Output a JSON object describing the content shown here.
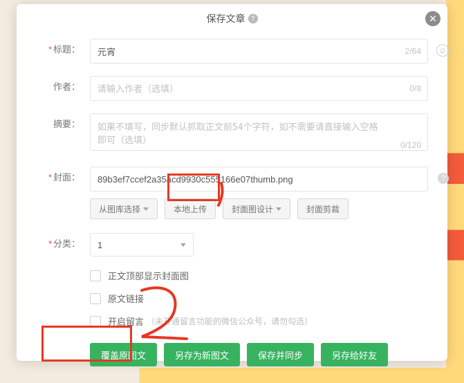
{
  "modal": {
    "title": "保存文章",
    "close_glyph": "✕"
  },
  "fields": {
    "title": {
      "label": "标题：",
      "value": "元宵",
      "counter": "2/64"
    },
    "author": {
      "label": "作者：",
      "placeholder": "请输入作者（选填）",
      "counter": "0/8"
    },
    "summary": {
      "label": "摘要：",
      "placeholder": "如果不填写，同步默认抓取正文前54个字符，如不需要请直接输入空格即可（选填）",
      "counter": "0/120"
    },
    "cover": {
      "label": "封面：",
      "value": "89b3ef7ccef2a35acd9930c555166e07thumb.png"
    },
    "category": {
      "label": "分类：",
      "value": "1"
    }
  },
  "cover_buttons": {
    "gallery": "从图库选择",
    "local": "本地上传",
    "design": "封面图设计",
    "crop": "封面剪裁"
  },
  "checks": {
    "show_cover": "正文顶部显示封面图",
    "orig_link": "原文链接",
    "comments": "开启留言",
    "comments_note": "（未开通留言功能的微信公众号，请勿勾选）"
  },
  "actions": {
    "overwrite": "覆盖原图文",
    "save_new": "另存为新图文",
    "save_sync": "保存并同步",
    "share": "另存给好友"
  }
}
